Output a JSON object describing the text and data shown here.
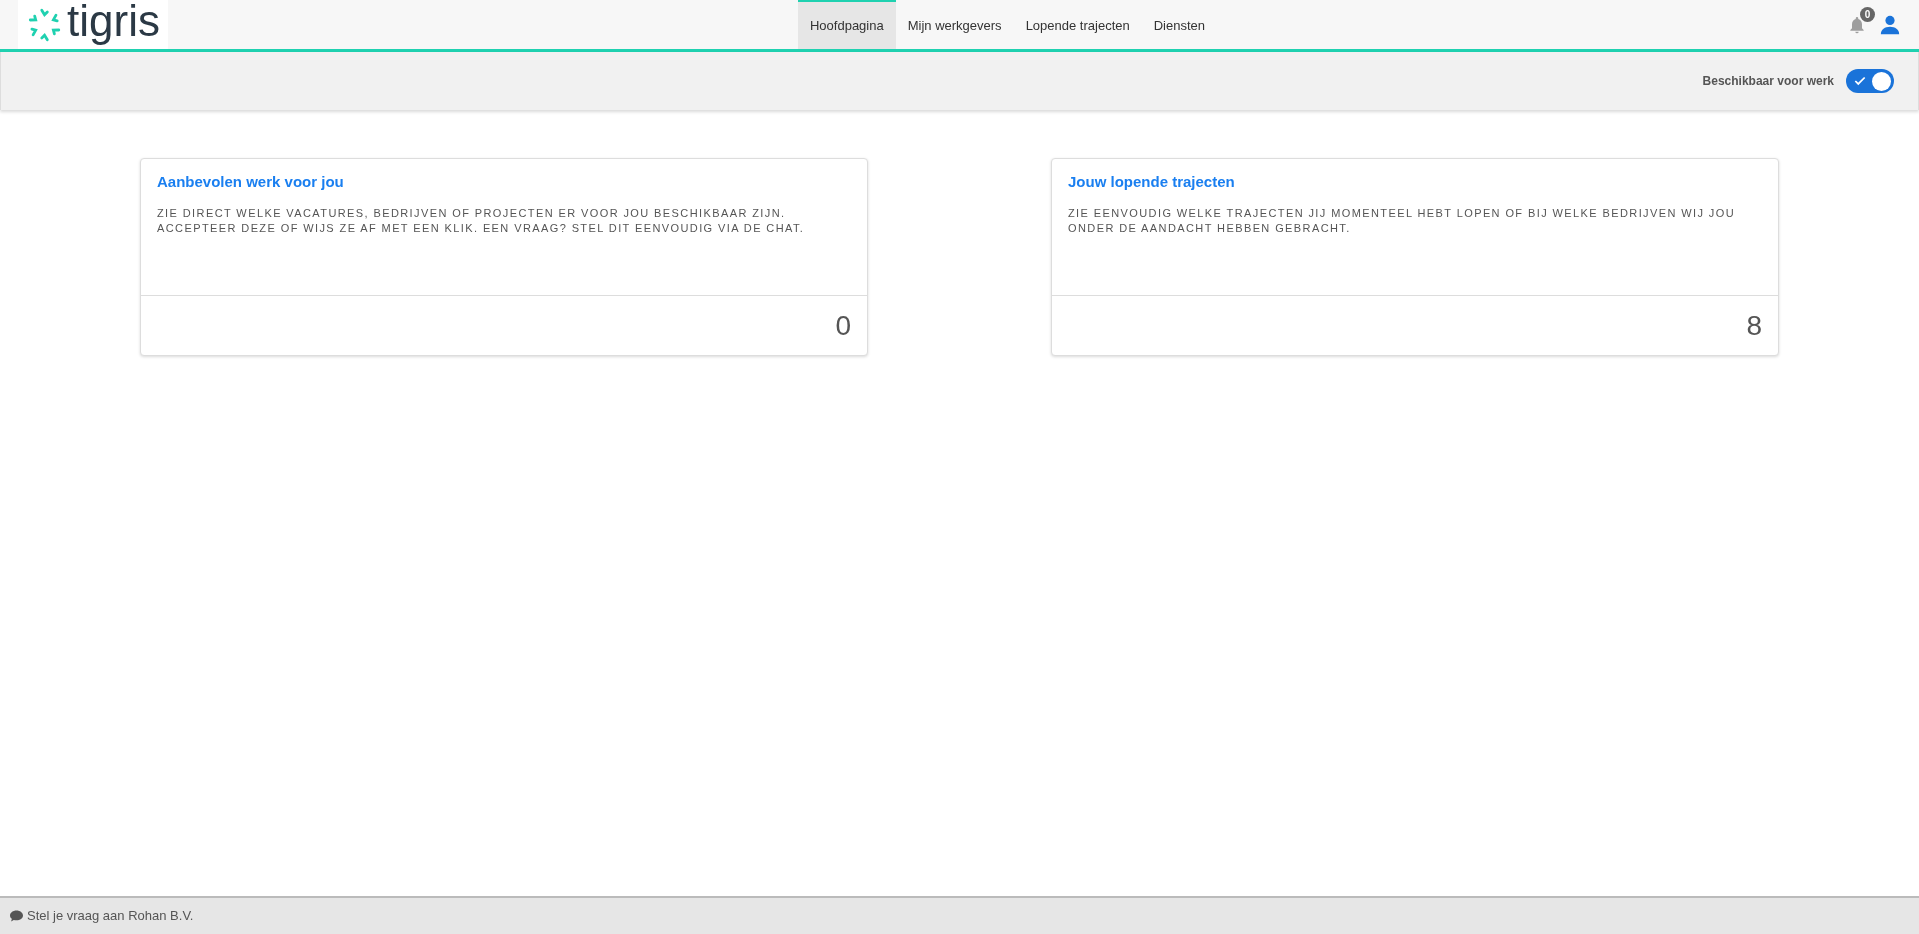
{
  "logo": {
    "text": "tigris"
  },
  "nav": [
    {
      "label": "Hoofdpagina",
      "selected": true
    },
    {
      "label": "Mijn werkgevers",
      "selected": false
    },
    {
      "label": "Lopende trajecten",
      "selected": false
    },
    {
      "label": "Diensten",
      "selected": false
    }
  ],
  "notifications": {
    "count": "0"
  },
  "availability": {
    "label": "Beschikbaar voor werk",
    "on": true
  },
  "cards": [
    {
      "title": "Aanbevolen werk voor jou",
      "description": "ZIE DIRECT WELKE VACATURES, BEDRIJVEN OF PROJECTEN ER VOOR JOU BESCHIKBAAR ZIJN. ACCEPTEER DEZE OF WIJS ZE AF MET EEN KLIK. EEN VRAAG? STEL DIT EENVOUDIG VIA DE CHAT.",
      "count": "0"
    },
    {
      "title": "Jouw lopende trajecten",
      "description": "ZIE EENVOUDIG WELKE TRAJECTEN JIJ MOMENTEEL HEBT LOPEN OF BIJ WELKE BEDRIJVEN WIJ JOU ONDER DE AANDACHT HEBBEN GEBRACHT.",
      "count": "8"
    }
  ],
  "chat_bar": {
    "text": "Stel je vraag aan Rohan B.V."
  }
}
